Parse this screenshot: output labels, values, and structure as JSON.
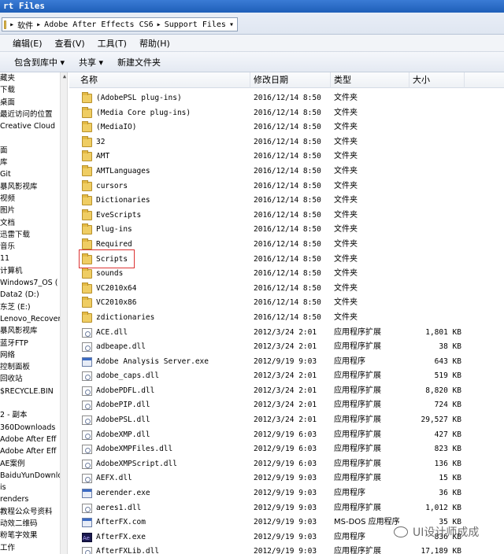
{
  "window": {
    "title": "rt Files"
  },
  "address": {
    "segments": [
      "▸",
      "软件",
      "▸",
      "Adobe After Effects CS6",
      "▸",
      "Support Files",
      "▾"
    ]
  },
  "menu": [
    "编辑(E)",
    "查看(V)",
    "工具(T)",
    "帮助(H)"
  ],
  "toolbar": [
    "包含到库中 ▾",
    "共享 ▾",
    "新建文件夹"
  ],
  "nav": [
    "藏夹",
    "下载",
    "桌面",
    "最近访问的位置",
    "Creative Cloud",
    "",
    "面",
    "库",
    "  Git",
    "  暴风影视库",
    "  视频",
    "  图片",
    "  文档",
    "  迅雷下载",
    "  音乐",
    "11",
    "计算机",
    "  Windows7_OS (",
    "  Data2 (D:)",
    "  东芝 (E:)",
    "Lenovo_Recover",
    "  暴风影视库",
    "  蓝牙FTP",
    "网络",
    "控制面板",
    "回收站",
    "$RECYCLE.BIN",
    "",
    "2 - 副本",
    "360Downloads",
    "Adobe After Eff",
    "Adobe After Eff",
    "AE案例",
    "BaiduYunDownloa",
    "is",
    "renders",
    "教程公众号资料",
    "动效二维码",
    "粉笔字效果",
    "工作"
  ],
  "columns": {
    "name": "名称",
    "date": "修改日期",
    "type": "类型",
    "size": "大小"
  },
  "files": [
    {
      "icon": "folder-icon",
      "name": "(AdobePSL plug-ins)",
      "date": "2016/12/14 8:50",
      "type": "文件夹",
      "size": ""
    },
    {
      "icon": "folder-icon",
      "name": "(Media Core plug-ins)",
      "date": "2016/12/14 8:50",
      "type": "文件夹",
      "size": ""
    },
    {
      "icon": "folder-icon",
      "name": "(MediaIO)",
      "date": "2016/12/14 8:50",
      "type": "文件夹",
      "size": ""
    },
    {
      "icon": "folder-icon",
      "name": "32",
      "date": "2016/12/14 8:50",
      "type": "文件夹",
      "size": ""
    },
    {
      "icon": "folder-icon",
      "name": "AMT",
      "date": "2016/12/14 8:50",
      "type": "文件夹",
      "size": ""
    },
    {
      "icon": "folder-icon",
      "name": "AMTLanguages",
      "date": "2016/12/14 8:50",
      "type": "文件夹",
      "size": ""
    },
    {
      "icon": "folder-icon",
      "name": "cursors",
      "date": "2016/12/14 8:50",
      "type": "文件夹",
      "size": ""
    },
    {
      "icon": "folder-icon",
      "name": "Dictionaries",
      "date": "2016/12/14 8:50",
      "type": "文件夹",
      "size": ""
    },
    {
      "icon": "folder-icon",
      "name": "EveScripts",
      "date": "2016/12/14 8:50",
      "type": "文件夹",
      "size": ""
    },
    {
      "icon": "folder-icon",
      "name": "Plug-ins",
      "date": "2016/12/14 8:50",
      "type": "文件夹",
      "size": ""
    },
    {
      "icon": "folder-icon",
      "name": "Required",
      "date": "2016/12/14 8:50",
      "type": "文件夹",
      "size": ""
    },
    {
      "icon": "folder-icon",
      "name": "Scripts",
      "date": "2016/12/14 8:50",
      "type": "文件夹",
      "size": ""
    },
    {
      "icon": "folder-icon",
      "name": "sounds",
      "date": "2016/12/14 8:50",
      "type": "文件夹",
      "size": ""
    },
    {
      "icon": "folder-icon",
      "name": "VC2010x64",
      "date": "2016/12/14 8:50",
      "type": "文件夹",
      "size": ""
    },
    {
      "icon": "folder-icon",
      "name": "VC2010x86",
      "date": "2016/12/14 8:50",
      "type": "文件夹",
      "size": ""
    },
    {
      "icon": "folder-icon",
      "name": "zdictionaries",
      "date": "2016/12/14 8:50",
      "type": "文件夹",
      "size": ""
    },
    {
      "icon": "dll-icon",
      "name": "ACE.dll",
      "date": "2012/3/24 2:01",
      "type": "应用程序扩展",
      "size": "1,801 KB"
    },
    {
      "icon": "dll-icon",
      "name": "adbeape.dll",
      "date": "2012/3/24 2:01",
      "type": "应用程序扩展",
      "size": "38 KB"
    },
    {
      "icon": "exe-icon",
      "name": "Adobe Analysis Server.exe",
      "date": "2012/9/19 9:03",
      "type": "应用程序",
      "size": "643 KB"
    },
    {
      "icon": "dll-icon",
      "name": "adobe_caps.dll",
      "date": "2012/3/24 2:01",
      "type": "应用程序扩展",
      "size": "519 KB"
    },
    {
      "icon": "dll-icon",
      "name": "AdobePDFL.dll",
      "date": "2012/3/24 2:01",
      "type": "应用程序扩展",
      "size": "8,820 KB"
    },
    {
      "icon": "dll-icon",
      "name": "AdobePIP.dll",
      "date": "2012/3/24 2:01",
      "type": "应用程序扩展",
      "size": "724 KB"
    },
    {
      "icon": "dll-icon",
      "name": "AdobePSL.dll",
      "date": "2012/3/24 2:01",
      "type": "应用程序扩展",
      "size": "29,527 KB"
    },
    {
      "icon": "dll-icon",
      "name": "AdobeXMP.dll",
      "date": "2012/9/19 6:03",
      "type": "应用程序扩展",
      "size": "427 KB"
    },
    {
      "icon": "dll-icon",
      "name": "AdobeXMPFiles.dll",
      "date": "2012/9/19 6:03",
      "type": "应用程序扩展",
      "size": "823 KB"
    },
    {
      "icon": "dll-icon",
      "name": "AdobeXMPScript.dll",
      "date": "2012/9/19 6:03",
      "type": "应用程序扩展",
      "size": "136 KB"
    },
    {
      "icon": "dll-icon",
      "name": "AEFX.dll",
      "date": "2012/9/19 9:03",
      "type": "应用程序扩展",
      "size": "15 KB"
    },
    {
      "icon": "exe-icon",
      "name": "aerender.exe",
      "date": "2012/9/19 9:03",
      "type": "应用程序",
      "size": "36 KB"
    },
    {
      "icon": "dll-icon",
      "name": "aeres1.dll",
      "date": "2012/9/19 9:03",
      "type": "应用程序扩展",
      "size": "1,012 KB"
    },
    {
      "icon": "exe-icon",
      "name": "AfterFX.com",
      "date": "2012/9/19 9:03",
      "type": "MS-DOS 应用程序",
      "size": "35 KB"
    },
    {
      "icon": "ae-icon",
      "name": "AfterFX.exe",
      "date": "2012/9/19 9:03",
      "type": "应用程序",
      "size": "836 KB"
    },
    {
      "icon": "dll-icon",
      "name": "AfterFXLib.dll",
      "date": "2012/9/19 9:03",
      "type": "应用程序扩展",
      "size": "17,189 KB"
    }
  ],
  "watermark": {
    "text": "UI设计师成成"
  }
}
